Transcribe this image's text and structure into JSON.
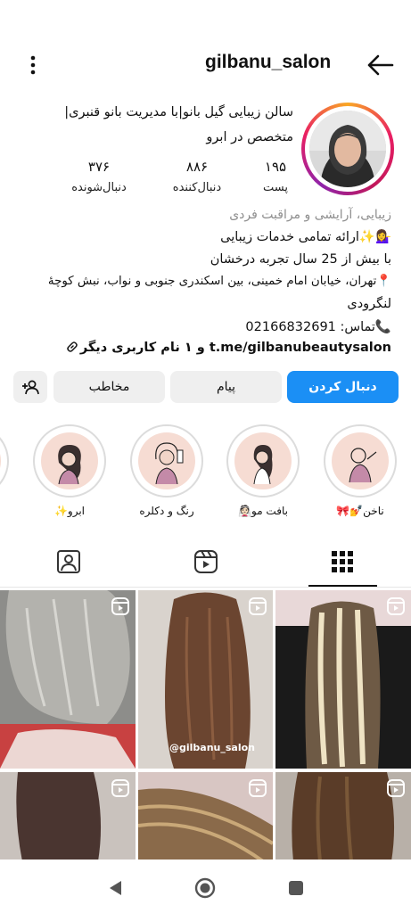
{
  "header": {
    "username": "gilbanu_salon"
  },
  "profile": {
    "title_line1": "سالن زیبایی گیل بانو|با مدیریت بانو قنبری|",
    "title_line2": "متخصص در ابرو",
    "stats": [
      {
        "value": "۱۹۵",
        "label": "پست"
      },
      {
        "value": "۸۸۶",
        "label": "دنبال‌کننده"
      },
      {
        "value": "۳۷۶",
        "label": "دنبال‌شونده"
      }
    ],
    "bio": {
      "category": "زیبایی، آرایشی و مراقبت فردی",
      "line1": "💁‍♀️✨ارائه تمامی خدمات زیبایی",
      "line2": "با بیش از 25 سال تجربه درخشان",
      "line3": "📍تهران، خیابان امام خمینی، بین اسکندری جنوبی و نواب، نبش کوچهٔ",
      "line4": "لنگرودی",
      "phone": "📞تماس: 02166832691",
      "link": "t.me/gilbanubeautysalon و ۱ نام کاربری دیگر"
    }
  },
  "buttons": {
    "follow": "دنبال کردن",
    "message": "پیام",
    "contact": "مخاطب"
  },
  "highlights": [
    {
      "label": "ناخن💅🎀"
    },
    {
      "label": "بافت مو👰🏻"
    },
    {
      "label": "رنگ و دکلره"
    },
    {
      "label": "ابرو✨"
    }
  ],
  "grid_watermark": "@gilbanu_salon",
  "colors": {
    "accent": "#1b8ff5",
    "button_bg": "#efefef",
    "category_text": "#8e8e8e"
  },
  "icons": [
    "more-vertical-icon",
    "back-arrow-icon",
    "add-person-icon",
    "tagged-icon",
    "reels-icon",
    "grid-icon",
    "reel-badge-icon",
    "nav-back-icon",
    "nav-home-icon",
    "nav-recents-icon"
  ]
}
